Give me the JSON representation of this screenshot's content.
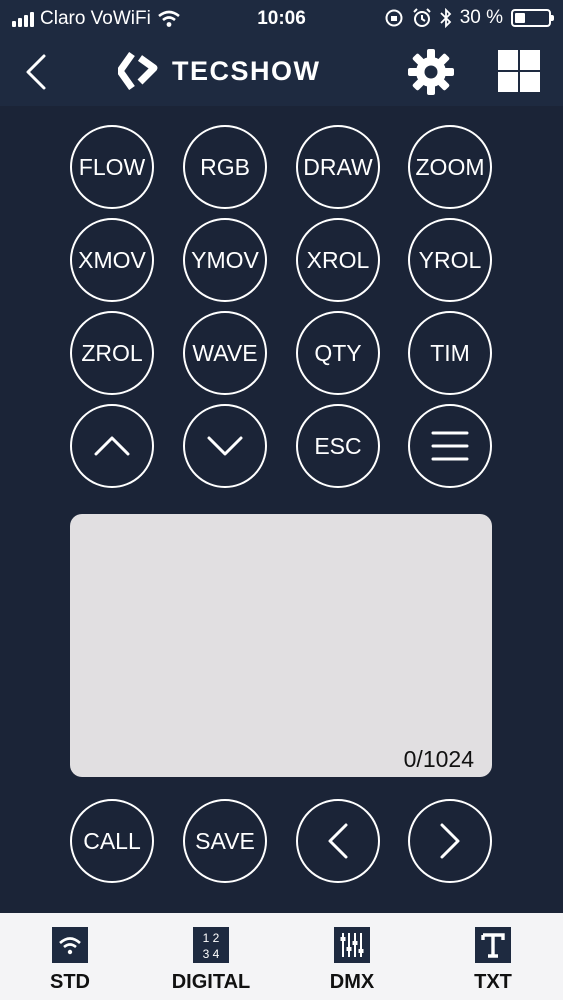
{
  "status_bar": {
    "carrier": "Claro VoWiFi",
    "time": "10:06",
    "battery_percent_text": "30 %",
    "battery_level": 0.3
  },
  "header": {
    "brand": "TECSHOW",
    "icons": [
      "back-chevron-icon",
      "logo-icon",
      "gear-icon",
      "grid-icon"
    ]
  },
  "buttons": {
    "row1": [
      "FLOW",
      "RGB",
      "DRAW",
      "ZOOM"
    ],
    "row2": [
      "XMOV",
      "YMOV",
      "XROL",
      "YROL"
    ],
    "row3": [
      "ZROL",
      "WAVE",
      "QTY",
      "TIM"
    ],
    "esc": "ESC",
    "call": "CALL",
    "save": "SAVE"
  },
  "text_area": {
    "counter": "0/1024"
  },
  "tabs": [
    {
      "label": "STD",
      "icon": "wifi-icon"
    },
    {
      "label": "DIGITAL",
      "icon": "digits-icon"
    },
    {
      "label": "DMX",
      "icon": "sliders-icon"
    },
    {
      "label": "TXT",
      "icon": "text-icon"
    }
  ],
  "colors": {
    "background": "#1b2437",
    "header": "#1e2a40",
    "text_area": "#e1dfe1",
    "tabbar": "#f4f4f6"
  }
}
